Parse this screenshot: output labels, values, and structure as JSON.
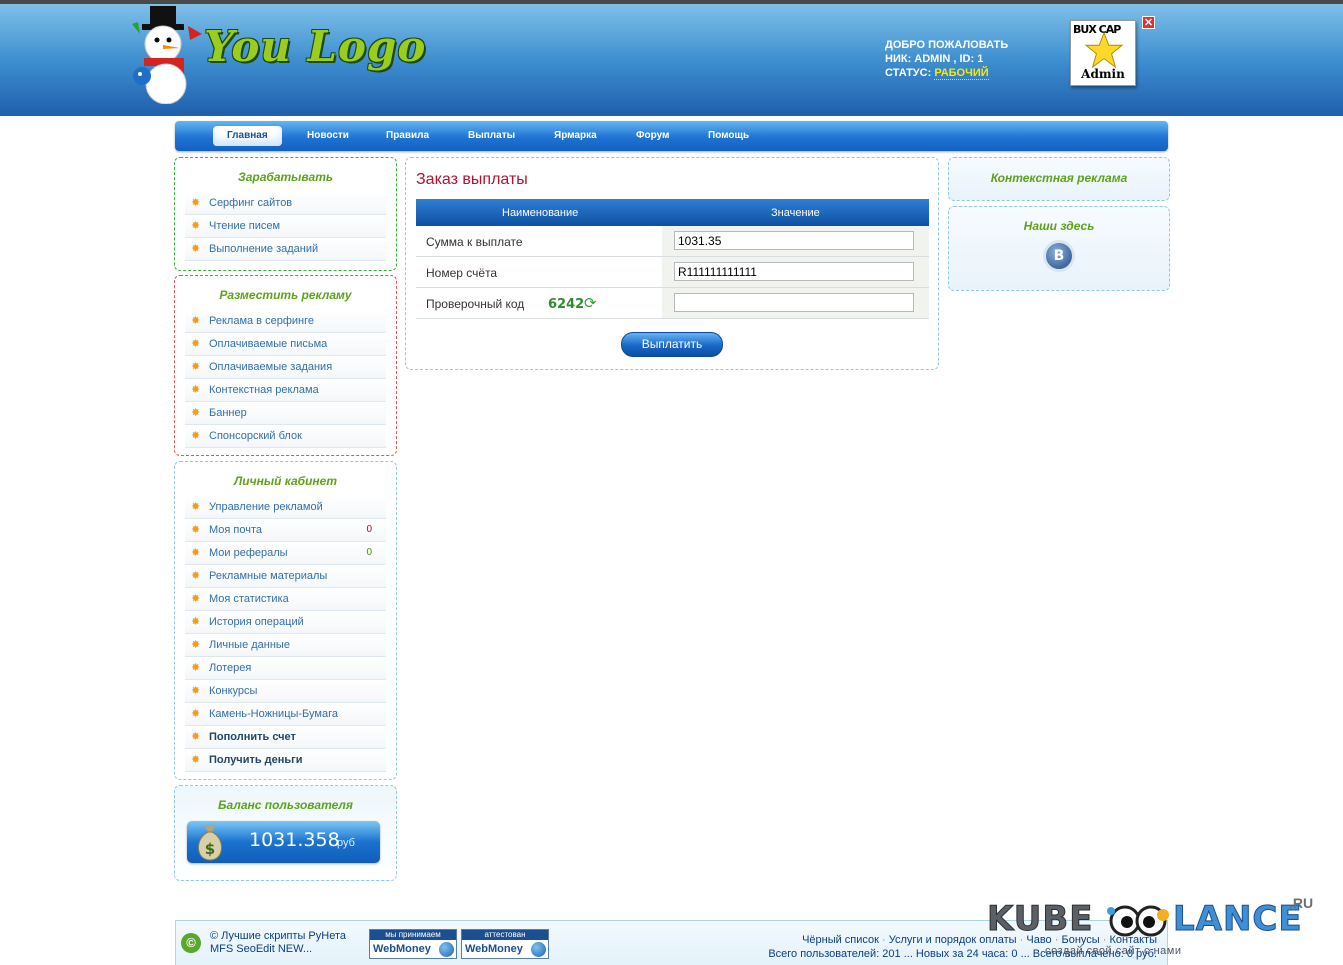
{
  "header": {
    "logo_text": "You Logo",
    "welcome_line": "ДОБРО ПОЖАЛОВАТЬ",
    "nick_line": "НИК: ADMIN , ID: 1",
    "status_label": "СТАТУС:",
    "status_value": "РАБОЧИЙ",
    "badge_top": "BUX CAP",
    "badge_bottom": "Admin"
  },
  "nav": {
    "items": [
      "Главная",
      "Новости",
      "Правила",
      "Выплаты",
      "Ярмарка",
      "Форум",
      "Помощь"
    ],
    "active": "Главная"
  },
  "sidebar": {
    "earn": {
      "title": "Зарабатывать",
      "items": [
        "Серфинг сайтов",
        "Чтение писем",
        "Выполнение заданий"
      ]
    },
    "advertise": {
      "title": "Разместить рекламу",
      "items": [
        "Реклама в серфинге",
        "Оплачиваемые письма",
        "Оплачиваемые задания",
        "Контекстная реклама",
        "Баннер",
        "Спонсорский блок"
      ]
    },
    "cabinet": {
      "title": "Личный кабинет",
      "items": [
        "Управление рекламой",
        "Моя почта",
        "Мои рефералы",
        "Рекламные материалы",
        "Моя статистика",
        "История операций",
        "Личные данные",
        "Лотерея",
        "Конкурсы",
        "Камень-Ножницы-Бумага",
        "Пополнить счет",
        "Получить деньги"
      ],
      "mail_count": "0",
      "referrals_count": "0"
    },
    "balance": {
      "title": "Баланс пользователя",
      "amount": "1031.358",
      "currency": "руб"
    }
  },
  "main": {
    "title": "Заказ выплаты",
    "col_name": "Наименование",
    "col_value": "Значение",
    "rows": [
      {
        "label": "Сумма к выплате",
        "value": "1031.35"
      },
      {
        "label": "Номер счёта",
        "value": "R111111111111"
      },
      {
        "label": "Проверочный код",
        "value": ""
      }
    ],
    "captcha": "6242",
    "submit": "Выплатить"
  },
  "right": {
    "context_title": "Контекстная реклама",
    "here_title": "Наши здесь",
    "vk_letter": "В"
  },
  "footer": {
    "copy_line1": "Лучшие скрипты РуНета",
    "copy_line2": "MFS SeoEdit NEW...",
    "wm1_top": "мы принимаем",
    "wm1_bottom": "WebMoney",
    "wm2_top": "аттестован",
    "wm2_bottom": "WebMoney",
    "links": [
      "Чёрный список",
      "Услуги и порядок оплаты",
      "Чаво",
      "Бонусы",
      "Контакты"
    ],
    "stats": "Всего пользователей: 201 ... Новых за 24 часа: 0 ... Всего выплачено: 0 руб."
  },
  "watermark": {
    "left": "KUBE",
    "right": "LANCE",
    "suffix": ".RU",
    "tagline": "создай свой сайт с нами"
  }
}
